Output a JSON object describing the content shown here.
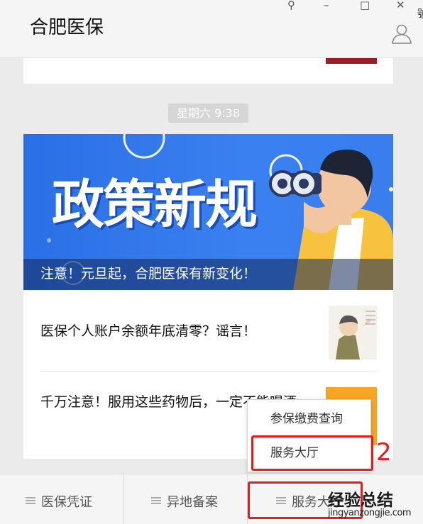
{
  "window": {
    "title": "合肥医保",
    "controls": {
      "pin": "⚲",
      "minimize": "–",
      "maximize": "□",
      "close": "✕"
    },
    "edge_text": "號"
  },
  "feed": {
    "timestamp": "星期六 9:38",
    "banner": {
      "headline": "政策新规",
      "caption": "注意！元旦起，合肥医保有新变化！"
    },
    "articles": [
      {
        "title": "医保个人账户余额年底清零？谣言！"
      },
      {
        "title": "千万注意！服用这些药物后，一定不能喝酒"
      }
    ]
  },
  "popup_menu": {
    "items": [
      {
        "label": "参保缴费查询"
      },
      {
        "label": "服务大厅"
      }
    ]
  },
  "annotation": {
    "step": "2",
    "color": "#e01e1e"
  },
  "tabbar": {
    "tabs": [
      {
        "label": "医保凭证"
      },
      {
        "label": "异地备案"
      },
      {
        "label": "服务大厅"
      }
    ]
  },
  "watermark": {
    "text": "经验总结",
    "url": "jingyanzongjie.com"
  },
  "colors": {
    "banner": "#2b6fe6",
    "accent_red": "#e01e1e",
    "prev_thumb": "#9d1a26"
  }
}
